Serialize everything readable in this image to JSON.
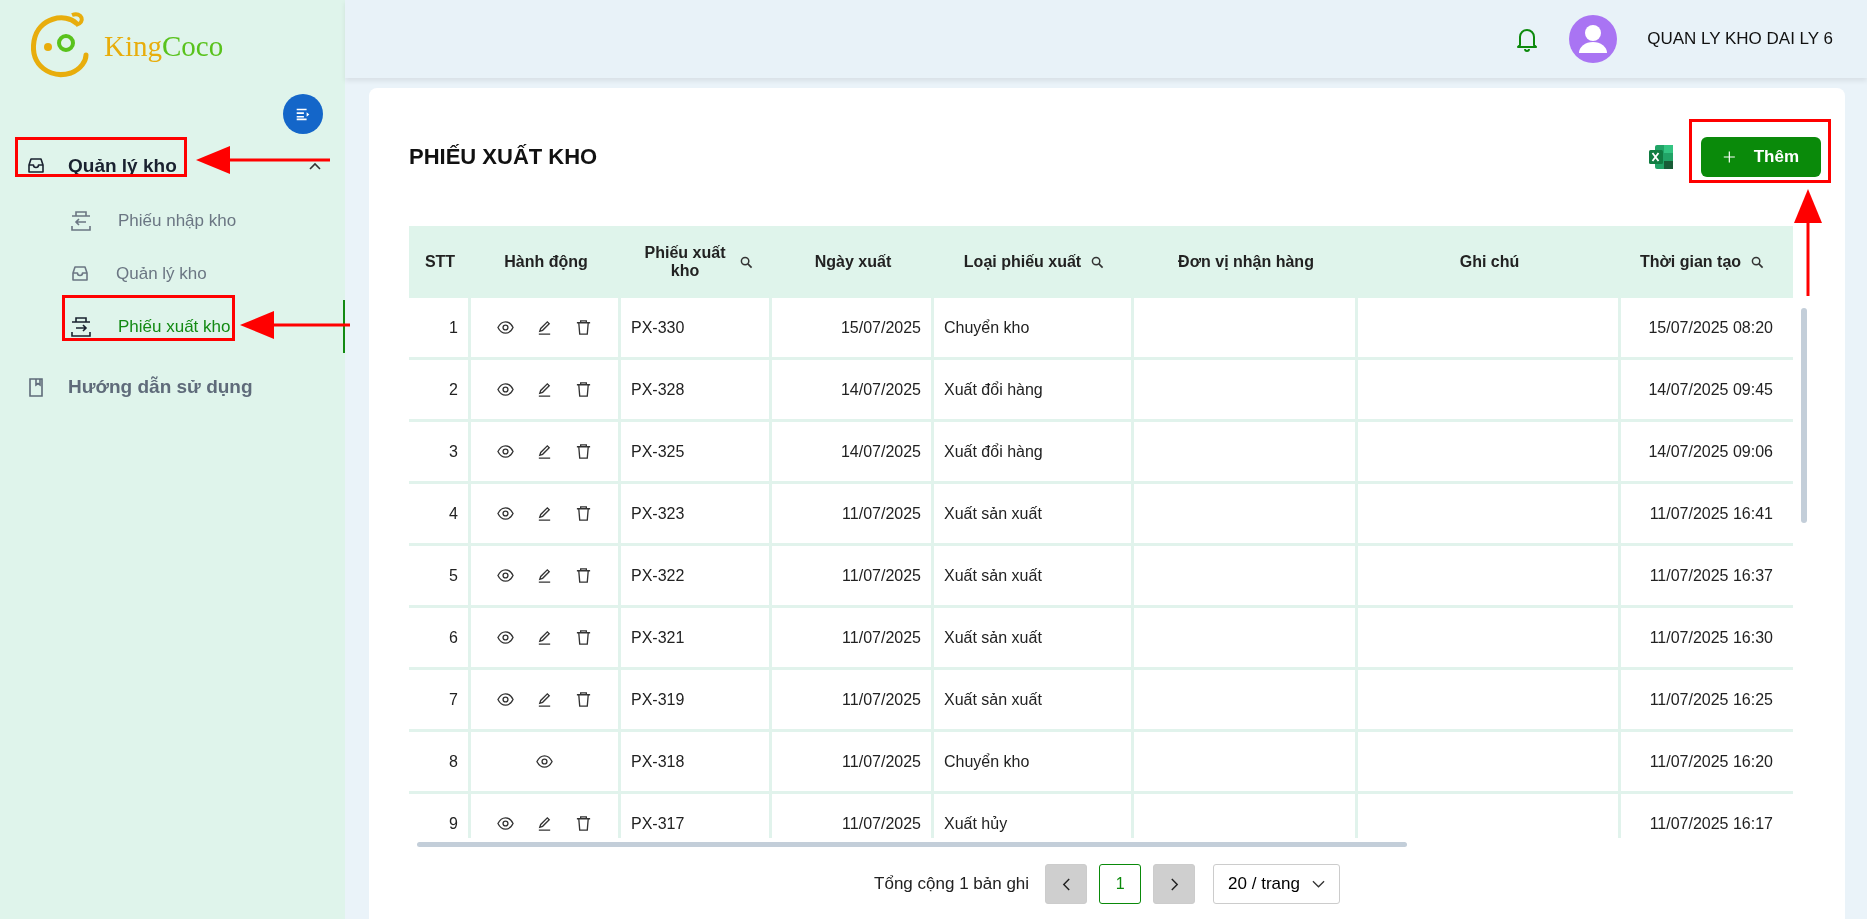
{
  "logo": {
    "text_a": "King",
    "text_b": "Coco"
  },
  "sidebar": {
    "items": [
      {
        "label": "Quản lý kho",
        "kind": "group",
        "expanded": true,
        "children": [
          {
            "label": "Phiếu nhập kho",
            "selected": false
          },
          {
            "label": "Quản lý kho",
            "selected": false
          },
          {
            "label": "Phiếu xuất kho",
            "selected": true
          }
        ]
      },
      {
        "label": "Hướng dẫn sử dụng",
        "kind": "link"
      }
    ]
  },
  "header": {
    "user_name": "QUAN LY KHO DAI LY 6"
  },
  "page": {
    "title": "PHIẾU XUẤT KHO",
    "add_button": "Thêm"
  },
  "table": {
    "columns": [
      {
        "kind": "stt",
        "label": "STT",
        "searchable": false
      },
      {
        "kind": "actions",
        "label": "Hành động",
        "searchable": false
      },
      {
        "kind": "code",
        "label": "Phiếu xuất kho",
        "searchable": true
      },
      {
        "kind": "date",
        "label": "Ngày xuất",
        "searchable": false
      },
      {
        "kind": "type",
        "label": "Loại phiếu xuất",
        "searchable": true
      },
      {
        "kind": "receiver",
        "label": "Đơn vị nhận hàng",
        "searchable": false
      },
      {
        "kind": "note",
        "label": "Ghi chú",
        "searchable": false
      },
      {
        "kind": "created",
        "label": "Thời gian tạo",
        "searchable": true
      }
    ],
    "rows": [
      {
        "stt": "1",
        "can_edit": true,
        "can_delete": true,
        "code": "PX-330",
        "date": "15/07/2025",
        "type": "Chuyển kho",
        "created": "15/07/2025 08:20"
      },
      {
        "stt": "2",
        "can_edit": true,
        "can_delete": true,
        "code": "PX-328",
        "date": "14/07/2025",
        "type": "Xuất đổi hàng",
        "created": "14/07/2025 09:45"
      },
      {
        "stt": "3",
        "can_edit": true,
        "can_delete": true,
        "code": "PX-325",
        "date": "14/07/2025",
        "type": "Xuất đổi hàng",
        "created": "14/07/2025 09:06"
      },
      {
        "stt": "4",
        "can_edit": true,
        "can_delete": true,
        "code": "PX-323",
        "date": "11/07/2025",
        "type": "Xuất sản xuất",
        "created": "11/07/2025 16:41"
      },
      {
        "stt": "5",
        "can_edit": true,
        "can_delete": true,
        "code": "PX-322",
        "date": "11/07/2025",
        "type": "Xuất sản xuất",
        "created": "11/07/2025 16:37"
      },
      {
        "stt": "6",
        "can_edit": true,
        "can_delete": true,
        "code": "PX-321",
        "date": "11/07/2025",
        "type": "Xuất sản xuất",
        "created": "11/07/2025 16:30"
      },
      {
        "stt": "7",
        "can_edit": true,
        "can_delete": true,
        "code": "PX-319",
        "date": "11/07/2025",
        "type": "Xuất sản xuất",
        "created": "11/07/2025 16:25"
      },
      {
        "stt": "8",
        "can_edit": false,
        "can_delete": false,
        "code": "PX-318",
        "date": "11/07/2025",
        "type": "Chuyển kho",
        "created": "11/07/2025 16:20"
      },
      {
        "stt": "9",
        "can_edit": true,
        "can_delete": true,
        "code": "PX-317",
        "date": "11/07/2025",
        "type": "Xuất hủy",
        "created": "11/07/2025 16:17"
      }
    ]
  },
  "pagination": {
    "summary": "Tổng cộng 1 bản ghi",
    "pages": [
      {
        "label": "1",
        "selected": true
      }
    ],
    "page_size": "20 / trang"
  }
}
